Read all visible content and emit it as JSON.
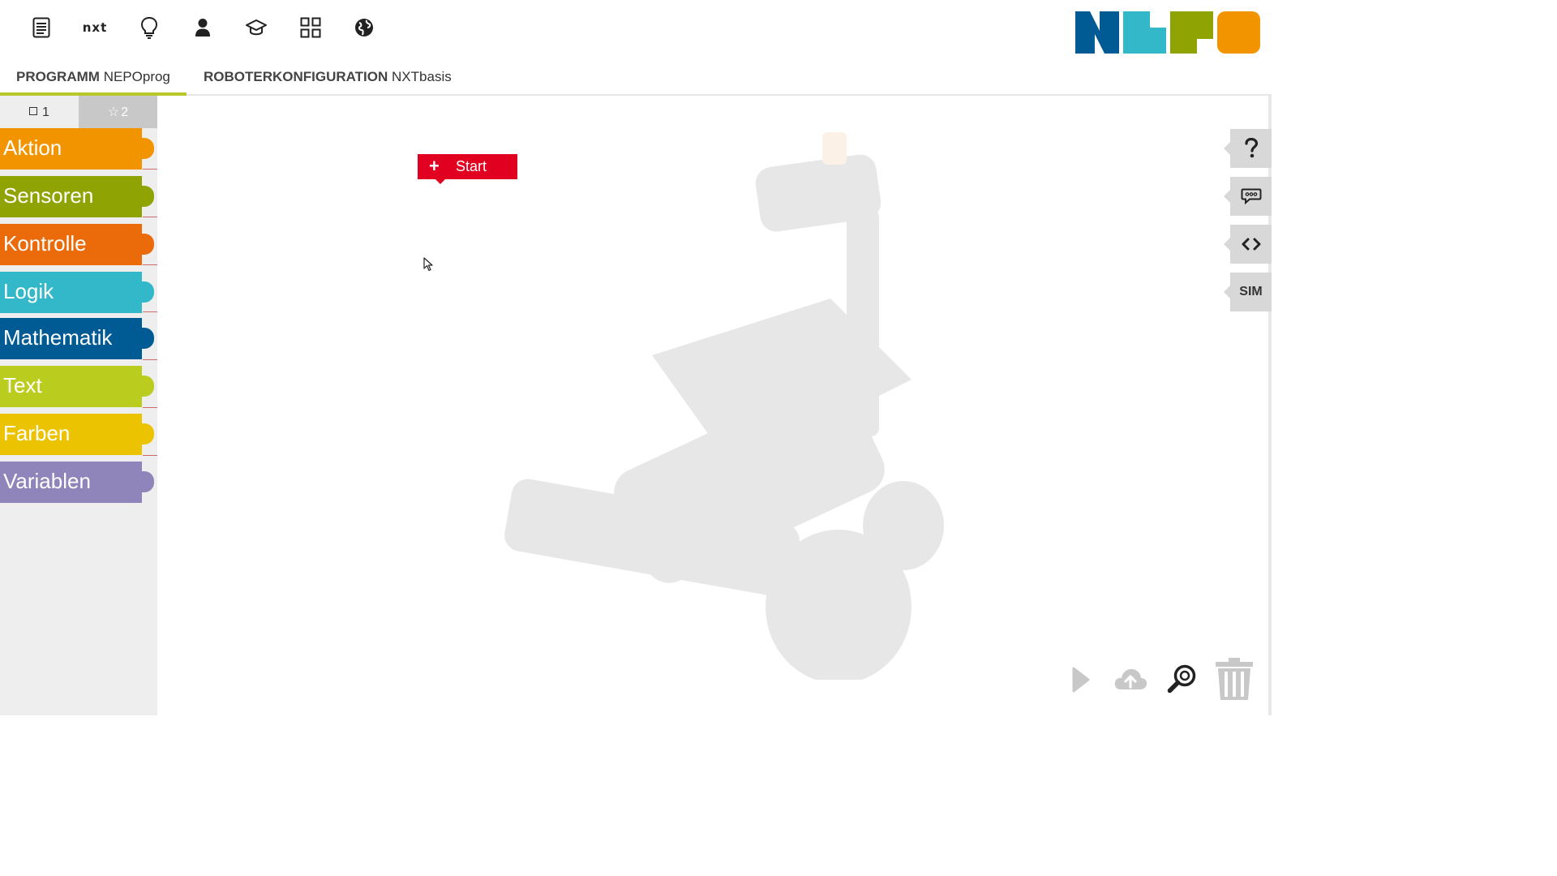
{
  "menu": {
    "icons": [
      "document-icon",
      "nxt-robot-menu",
      "lightbulb-icon",
      "user-icon",
      "graduation-cap-icon",
      "grid-icon",
      "globe-icon"
    ],
    "robot_label": "nxt"
  },
  "tabs": {
    "program_label": "PROGRAMM",
    "program_name": "NEPOprog",
    "config_label": "ROBOTERKONFIGURATION",
    "config_name": "NXTbasis"
  },
  "toolbox": {
    "level1_label": "1",
    "level2_label": "2",
    "categories": [
      {
        "label": "Aktion",
        "color": "#f29400"
      },
      {
        "label": "Sensoren",
        "color": "#8fa402"
      },
      {
        "label": "Kontrolle",
        "color": "#eb6a0a"
      },
      {
        "label": "Logik",
        "color": "#33b8ca"
      },
      {
        "label": "Mathematik",
        "color": "#005a94"
      },
      {
        "label": "Text",
        "color": "#bacc1e"
      },
      {
        "label": "Farben",
        "color": "#ebc300"
      },
      {
        "label": "Variablen",
        "color": "#9085ba"
      }
    ]
  },
  "workspace": {
    "start_block_label": "Start",
    "start_block_color": "#e1001f"
  },
  "side_tools": {
    "sim_label": "SIM"
  },
  "colors": {
    "logo": [
      "#005a94",
      "#33b8ca",
      "#8fa402",
      "#f29400"
    ],
    "tab_underline": "#b8c72a"
  }
}
